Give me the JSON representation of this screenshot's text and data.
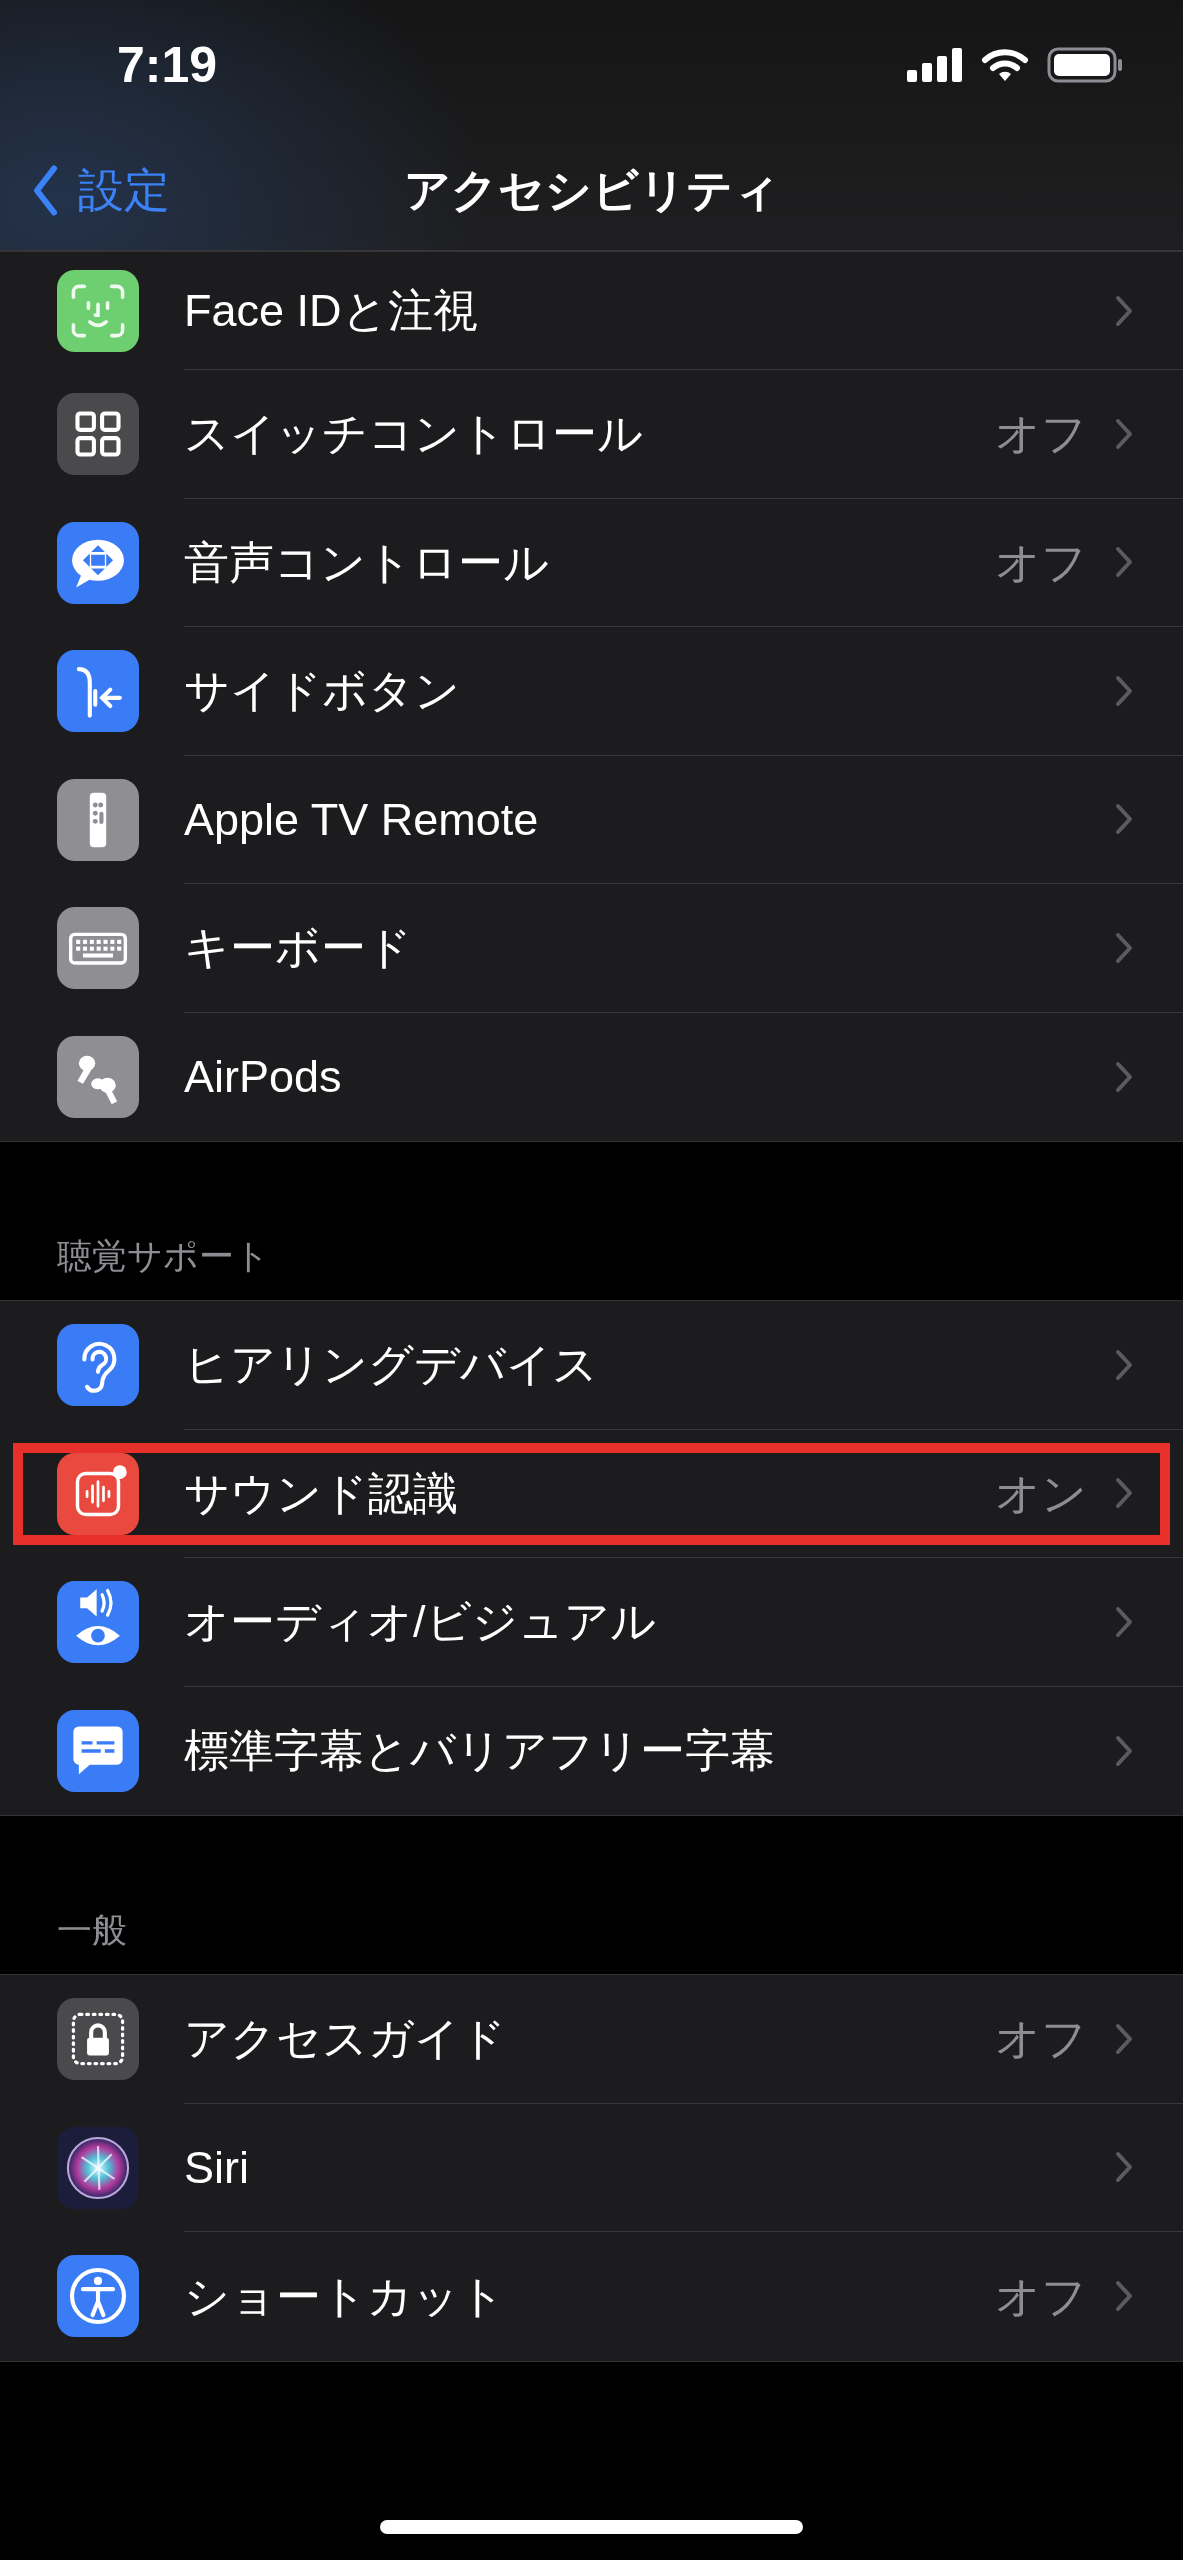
{
  "status_bar": {
    "time": "7:19"
  },
  "nav": {
    "back": "設定",
    "title": "アクセシビリティ"
  },
  "sections": [
    {
      "rows": [
        {
          "label": "Face IDと注視",
          "color": "#6dcf6f",
          "highlighted": false
        },
        {
          "label": "スイッチコントロール",
          "value": "オフ",
          "color": "#4a4a4d",
          "highlighted": false
        },
        {
          "label": "音声コントロール",
          "value": "オフ",
          "color": "#3a7cf5",
          "highlighted": false
        },
        {
          "label": "サイドボタン",
          "color": "#3a7cf5",
          "highlighted": false
        },
        {
          "label": "Apple TV Remote",
          "color": "#8e8e93",
          "highlighted": false
        },
        {
          "label": "キーボード",
          "color": "#8e8e93",
          "highlighted": false
        },
        {
          "label": "AirPods",
          "color": "#8e8e93",
          "highlighted": false
        }
      ]
    },
    {
      "header": "聴覚サポート",
      "rows": [
        {
          "label": "ヒアリングデバイス",
          "color": "#3a7cf5",
          "highlighted": false
        },
        {
          "label": "サウンド認識",
          "value": "オン",
          "color": "#e9493e",
          "highlighted": true
        },
        {
          "label": "オーディオ/ビジュアル",
          "color": "#3a7cf5",
          "highlighted": false
        },
        {
          "label": "標準字幕とバリアフリー字幕",
          "color": "#3a7cf5",
          "highlighted": false
        }
      ]
    },
    {
      "header": "一般",
      "rows": [
        {
          "label": "アクセスガイド",
          "value": "オフ",
          "color": "#4a4a4d",
          "highlighted": false
        },
        {
          "label": "Siri",
          "color": "#1c1d3a",
          "highlighted": false
        },
        {
          "label": "ショートカット",
          "value": "オフ",
          "color": "#3a7cf5",
          "highlighted": false
        }
      ]
    }
  ]
}
